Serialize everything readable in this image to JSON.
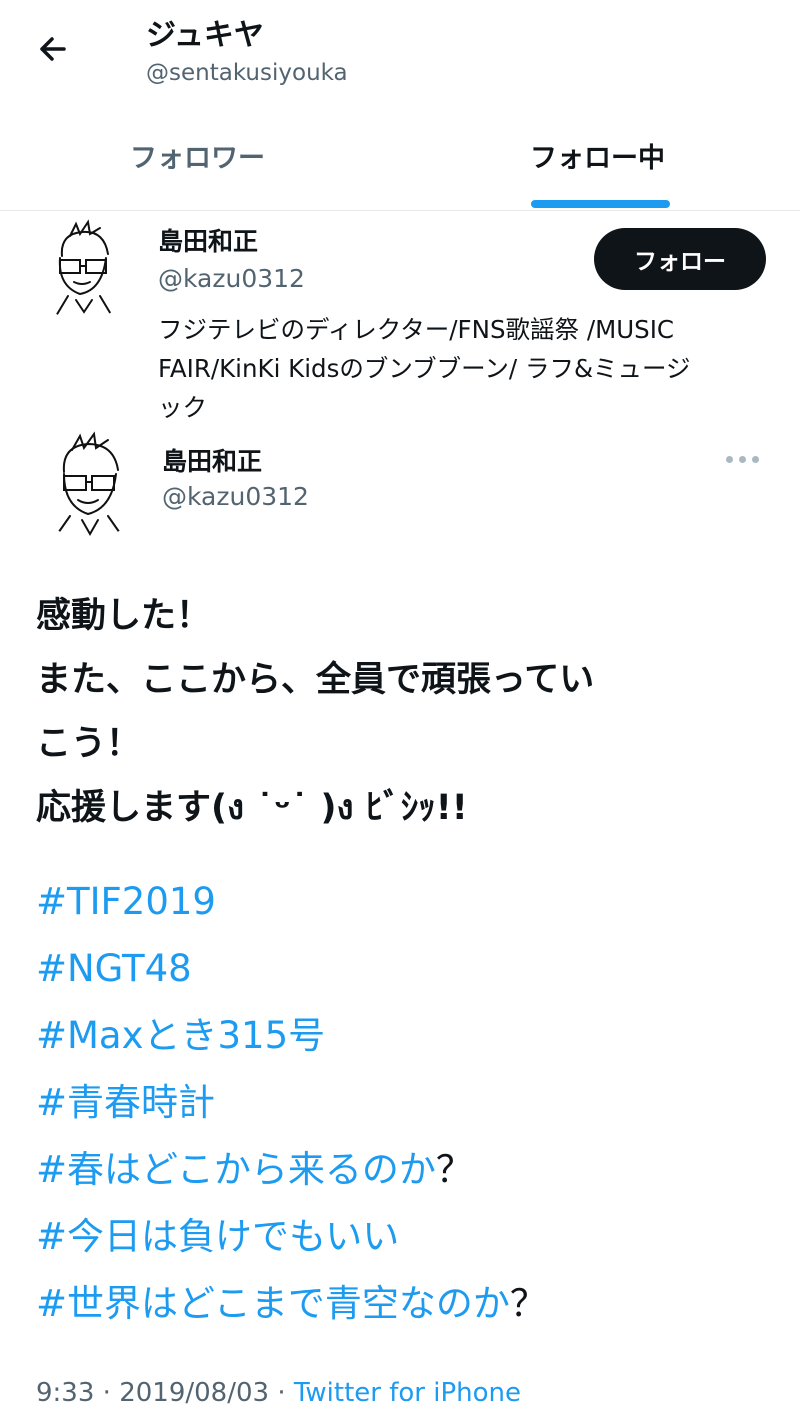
{
  "header": {
    "title": "ジュキヤ",
    "handle": "@sentakusiyouka",
    "tabs": [
      {
        "label": "フォロワー",
        "active": false
      },
      {
        "label": "フォロー中",
        "active": true
      }
    ]
  },
  "user_card": {
    "name": "島田和正",
    "handle": "@kazu0312",
    "follow_label": "フォロー",
    "bio_lines": [
      "フジテレビのディレクター/FNS歌謡祭 /MUSIC",
      "FAIR/KinKi Kidsのブンブブーン/ ラフ&ミュージ",
      "ック"
    ]
  },
  "tweet": {
    "author_name": "島田和正",
    "author_handle": "@kazu0312",
    "text_lines": [
      "感動した！",
      "また、ここから、全員で頑張ってい",
      "こう！",
      "応援します(ง ˙ᵕ˙ )ง ﾋﾞｼｯ!!"
    ],
    "hashtags": [
      {
        "tag": "#TIF2019",
        "suffix": ""
      },
      {
        "tag": "#NGT48",
        "suffix": ""
      },
      {
        "tag": "#Maxとき315号",
        "suffix": ""
      },
      {
        "tag": "#青春時計",
        "suffix": ""
      },
      {
        "tag": "#春はどこから来るのか",
        "suffix": "？"
      },
      {
        "tag": "#今日は負けでもいい",
        "suffix": ""
      },
      {
        "tag": "#世界はどこまで青空なのか",
        "suffix": "？"
      }
    ],
    "time": "9:33",
    "date": "2019/08/03",
    "separator": "·",
    "source": "Twitter for iPhone"
  },
  "colors": {
    "accent": "#1d9bf0",
    "text": "#0f1419",
    "secondary": "#536471",
    "button_bg": "#0f1419"
  },
  "icons": [
    "arrow-left-icon",
    "more-horizontal-icon",
    "avatar-sketch"
  ]
}
